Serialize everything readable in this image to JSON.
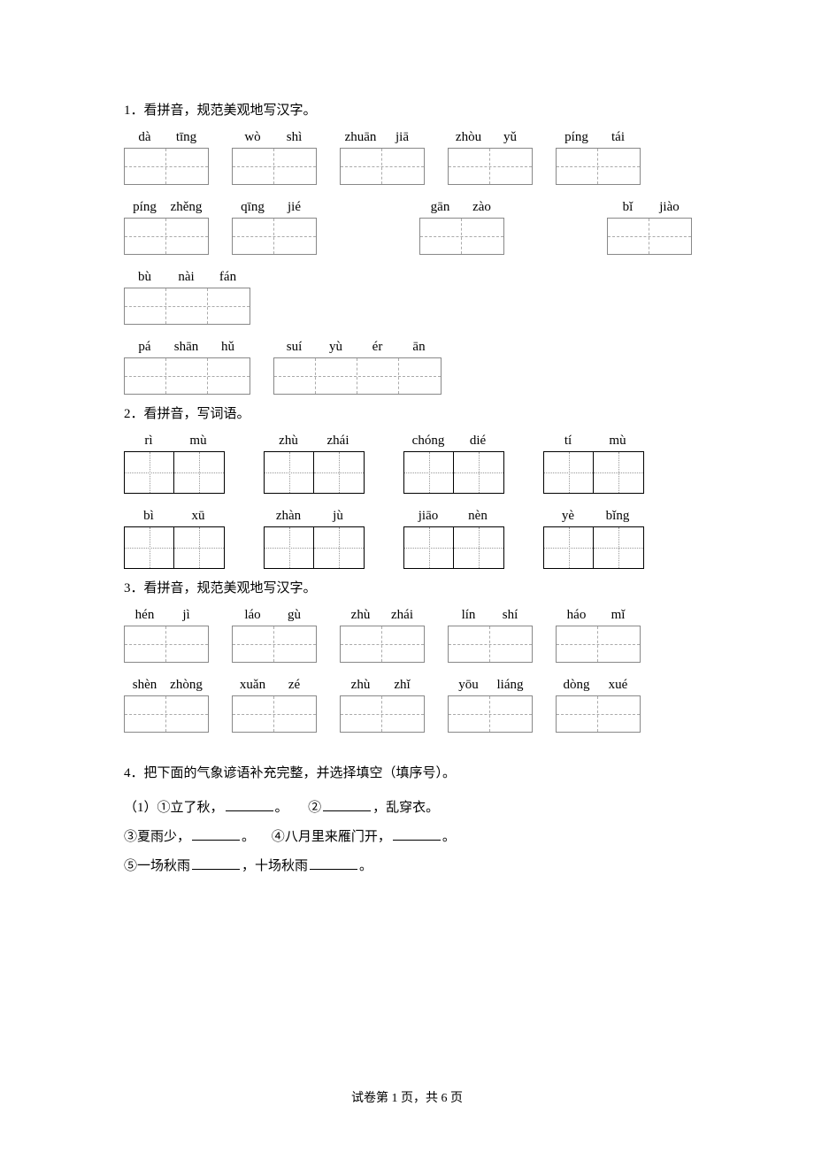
{
  "q1": {
    "title": "1．看拼音，规范美观地写汉字。",
    "rows": [
      [
        {
          "p": [
            "dà",
            "tīng"
          ],
          "cells": 2,
          "cw": 47
        },
        {
          "p": [
            "wò",
            "shì"
          ],
          "cells": 2,
          "cw": 47
        },
        {
          "p": [
            "zhuān",
            "jiā"
          ],
          "cells": 2,
          "cw": 47
        },
        {
          "p": [
            "zhòu",
            "yǔ"
          ],
          "cells": 2,
          "cw": 47
        },
        {
          "p": [
            "píng",
            "tái"
          ],
          "cells": 2,
          "cw": 47
        }
      ],
      [
        {
          "p": [
            "píng",
            "zhěng"
          ],
          "cells": 2,
          "cw": 47
        },
        {
          "p": [
            "qīng",
            "jié"
          ],
          "cells": 2,
          "cw": 47
        },
        {
          "p": [
            "gān",
            "zào"
          ],
          "cells": 2,
          "cw": 47,
          "leadgap": 90
        },
        {
          "p": [
            "bǐ",
            "jiào"
          ],
          "cells": 2,
          "cw": 47,
          "leadgap": 90
        }
      ],
      [
        {
          "p": [
            "bù",
            "nài",
            "fán"
          ],
          "cells": 3,
          "cw": 47
        }
      ],
      [
        {
          "p": [
            "pá",
            "shān",
            "hǔ"
          ],
          "cells": 3,
          "cw": 47
        },
        {
          "p": [
            "suí",
            "yù",
            "ér",
            "ān"
          ],
          "cells": 4,
          "cw": 47
        }
      ]
    ]
  },
  "q2": {
    "title": "2．看拼音，写词语。",
    "rows": [
      [
        {
          "p": [
            "rì",
            "mù"
          ]
        },
        {
          "p": [
            "zhù",
            "zhái"
          ]
        },
        {
          "p": [
            "chóng",
            "dié"
          ]
        },
        {
          "p": [
            "tí",
            "mù"
          ]
        }
      ],
      [
        {
          "p": [
            "bì",
            "xū"
          ]
        },
        {
          "p": [
            "zhàn",
            "jù"
          ]
        },
        {
          "p": [
            "jiāo",
            "nèn"
          ]
        },
        {
          "p": [
            "yè",
            "bǐng"
          ]
        }
      ]
    ]
  },
  "q3": {
    "title": "3．看拼音，规范美观地写汉字。",
    "rows": [
      [
        {
          "p": [
            "hén",
            "jì"
          ],
          "cells": 2,
          "cw": 47
        },
        {
          "p": [
            "láo",
            "gù"
          ],
          "cells": 2,
          "cw": 47
        },
        {
          "p": [
            "zhù",
            "zhái"
          ],
          "cells": 2,
          "cw": 47
        },
        {
          "p": [
            "lín",
            "shí"
          ],
          "cells": 2,
          "cw": 47
        },
        {
          "p": [
            "háo",
            "mǐ"
          ],
          "cells": 2,
          "cw": 47
        }
      ],
      [
        {
          "p": [
            "shèn",
            "zhòng"
          ],
          "cells": 2,
          "cw": 47
        },
        {
          "p": [
            "xuǎn",
            "zé"
          ],
          "cells": 2,
          "cw": 47
        },
        {
          "p": [
            "zhù",
            "zhǐ"
          ],
          "cells": 2,
          "cw": 47
        },
        {
          "p": [
            "yōu",
            "liáng"
          ],
          "cells": 2,
          "cw": 47
        },
        {
          "p": [
            "dòng",
            "xué"
          ],
          "cells": 2,
          "cw": 47
        }
      ]
    ]
  },
  "q4": {
    "title": "4．把下面的气象谚语补充完整，并选择填空（填序号）。",
    "lines": {
      "l1_a_num": "①",
      "l1_a_text": "立了秋，",
      "l1_a_after": "。",
      "l1_b_num": "②",
      "l1_b_after": "，乱穿衣。",
      "l2_a_num": "③",
      "l2_a_text": "夏雨少，",
      "l2_a_after": "。",
      "l2_b_num": "④",
      "l2_b_text": "八月里来雁门开，",
      "l2_b_after": "。",
      "l3_num": "⑤",
      "l3_a": "一场秋雨",
      "l3_mid": "，十场秋雨",
      "l3_after": "。"
    },
    "paren_open": "（1）"
  },
  "footer": "试卷第 1 页，共 6 页"
}
